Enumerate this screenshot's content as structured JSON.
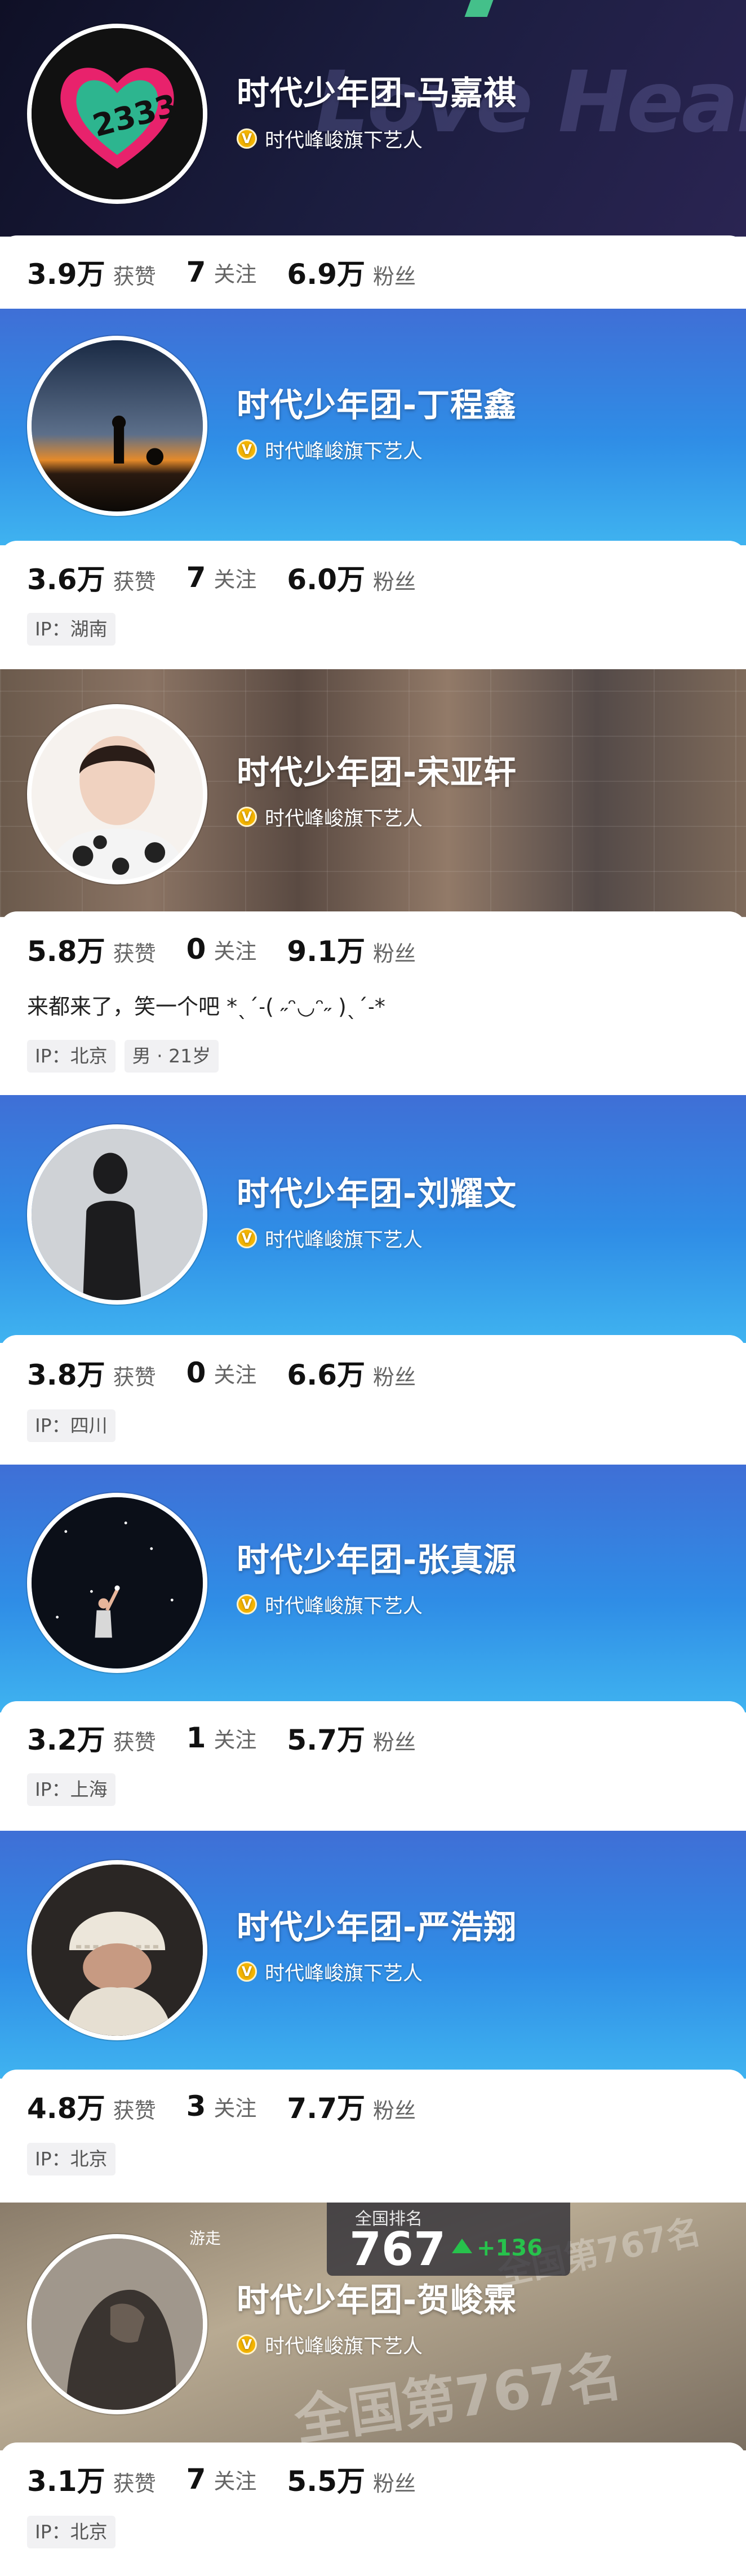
{
  "profiles": [
    {
      "name": "时代少年团-马嘉祺",
      "verification": "时代峰峻旗下艺人",
      "stats": [
        {
          "num": "3.9万",
          "label": "获赞"
        },
        {
          "num": "7",
          "label": "关注"
        },
        {
          "num": "6.9万",
          "label": "粉丝"
        }
      ],
      "banner_text": "Love Heart"
    },
    {
      "name": "时代少年团-丁程鑫",
      "verification": "时代峰峻旗下艺人",
      "stats": [
        {
          "num": "3.6万",
          "label": "获赞"
        },
        {
          "num": "7",
          "label": "关注"
        },
        {
          "num": "6.0万",
          "label": "粉丝"
        }
      ],
      "tags": [
        "IP：湖南"
      ]
    },
    {
      "name": "时代少年团-宋亚轩",
      "verification": "时代峰峻旗下艺人",
      "stats": [
        {
          "num": "5.8万",
          "label": "获赞"
        },
        {
          "num": "0",
          "label": "关注"
        },
        {
          "num": "9.1万",
          "label": "粉丝"
        }
      ],
      "bio": "来都来了，笑一个吧 *ˎˊ˗( ˶ᵔ◡ᵔ˶ )ˎˊ˗*",
      "tags": [
        "IP：北京",
        "男 · 21岁"
      ]
    },
    {
      "name": "时代少年团-刘耀文",
      "verification": "时代峰峻旗下艺人",
      "stats": [
        {
          "num": "3.8万",
          "label": "获赞"
        },
        {
          "num": "0",
          "label": "关注"
        },
        {
          "num": "6.6万",
          "label": "粉丝"
        }
      ],
      "tags": [
        "IP：四川"
      ]
    },
    {
      "name": "时代少年团-张真源",
      "verification": "时代峰峻旗下艺人",
      "stats": [
        {
          "num": "3.2万",
          "label": "获赞"
        },
        {
          "num": "1",
          "label": "关注"
        },
        {
          "num": "5.7万",
          "label": "粉丝"
        }
      ],
      "tags": [
        "IP：上海"
      ]
    },
    {
      "name": "时代少年团-严浩翔",
      "verification": "时代峰峻旗下艺人",
      "stats": [
        {
          "num": "4.8万",
          "label": "获赞"
        },
        {
          "num": "3",
          "label": "关注"
        },
        {
          "num": "7.7万",
          "label": "粉丝"
        }
      ],
      "tags": [
        "IP：北京"
      ]
    },
    {
      "name": "时代少年团-贺峻霖",
      "verification": "时代峰峻旗下艺人",
      "stats": [
        {
          "num": "3.1万",
          "label": "获赞"
        },
        {
          "num": "7",
          "label": "关注"
        },
        {
          "num": "5.5万",
          "label": "粉丝"
        }
      ],
      "tags": [
        "IP：北京"
      ],
      "rank_overlay": {
        "title": "全国排名",
        "left_label": "游走",
        "rank": "767",
        "change": "+136",
        "watermark": "全国第767名"
      }
    }
  ],
  "colors": {
    "verify_badge": "#f4b400",
    "rank_up": "#27c24c",
    "blue_banner": "#2f8de6"
  }
}
